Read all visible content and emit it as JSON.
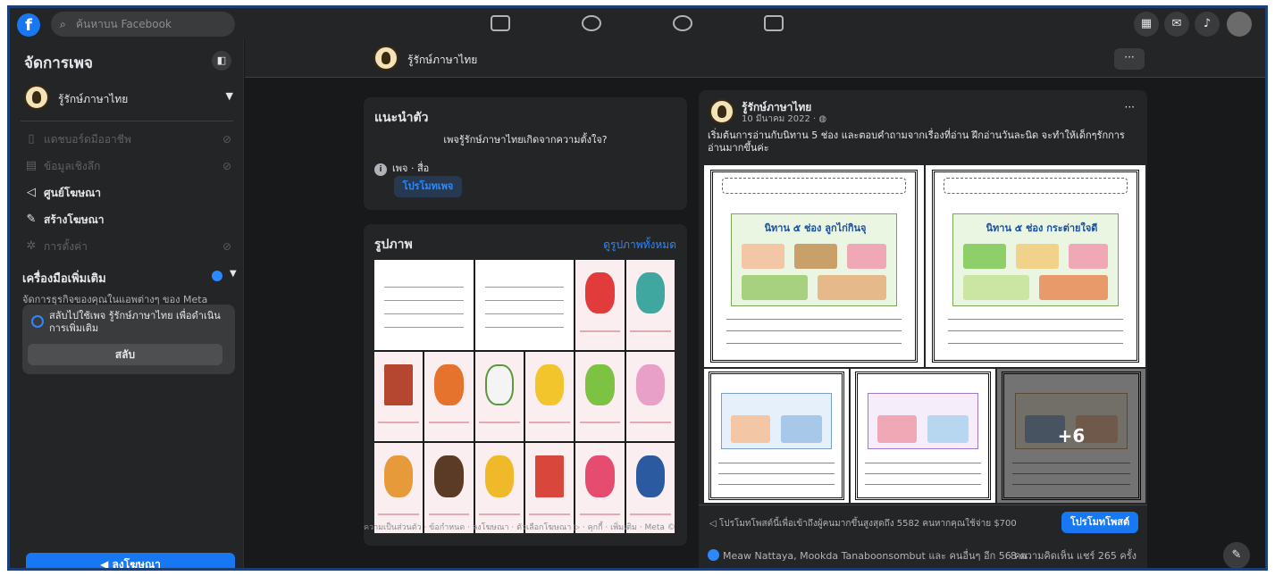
{
  "topbar": {
    "logo": "f",
    "search_placeholder": "ค้นหาบน Facebook"
  },
  "sidebar": {
    "title": "จัดการเพจ",
    "page_name": "รู้รักษ์ภาษาไทย",
    "items": [
      {
        "label": "แดชบอร์ดมืออาชีพ",
        "icon": "dashboard-icon",
        "state": "locked"
      },
      {
        "label": "ข้อมูลเชิงลึก",
        "icon": "insights-icon",
        "state": "locked"
      },
      {
        "label": "ศูนย์โฆษณา",
        "icon": "megaphone-icon",
        "state": "active"
      },
      {
        "label": "สร้างโฆษณา",
        "icon": "pencil-icon",
        "state": "active"
      },
      {
        "label": "การตั้งค่า",
        "icon": "gear-icon",
        "state": "locked"
      }
    ],
    "tools_title": "เครื่องมือเพิ่มเติม",
    "tools_subtitle": "จัดการธุรกิจของคุณในแอพต่างๆ ของ Meta",
    "switch_text": "สลับไปใช้เพจ รู้รักษ์ภาษาไทย เพื่อดำเนินการเพิ่มเติม",
    "switch_button": "สลับ",
    "ad_button": "ลงโฆษณา"
  },
  "page_header": {
    "page_name": "รู้รักษ์ภาษาไทย",
    "more": "···"
  },
  "intro": {
    "title": "แนะนำตัว",
    "description": "เพจรู้รักษ์ภาษาไทยเกิดจากความตั้งใจ?",
    "category": "เพจ · สื่อ",
    "promote_button": "โปรโมทเพจ"
  },
  "photos": {
    "title": "รูปภาพ",
    "see_all": "ดูรูปภาพทั้งหมด"
  },
  "footer_links": "ความเป็นส่วนตัว · ข้อกำหนด · ลงโฆษณา · ตัวเลือกโฆษณา ▷ · คุกกี้ · เพิ่มเติม · Meta ©",
  "post": {
    "author": "รู้รักษ์ภาษาไทย",
    "date": "10 มีนาคม 2022 · ",
    "more": "···",
    "text": "เริ่มต้นการอ่านกับนิทาน 5 ช่อง และตอบคำถามจากเรื่องที่อ่าน ฝึกอ่านวันละนิด จะทำให้เด็กๆรักการอ่านมากขึ้นค่ะ",
    "worksheet_titles": [
      "นิทาน ๕ ช่อง ลูกไก่กินจุ",
      "นิทาน ๕ ช่อง กระต่ายใจดี"
    ],
    "more_photos": "+6",
    "promo_text": "โปรโมทโพสต์นี้เพื่อเข้าถึงผู้คนมากขึ้นสูงสุดถึง 5582 คนหากคุณใช้จ่าย $700",
    "promo_button": "โปรโมทโพสต์",
    "reactions": "Meaw Nattaya, Mookda Tanaboonsombut และ คนอื่นๆ อีก 56 คน",
    "counts": "8 ความคิดเห็น  แชร์ 265 ครั้ง"
  },
  "colors": {
    "background": "#18191a",
    "surface": "#242526",
    "accent": "#1877f2",
    "link": "#2d88ff",
    "frame": "#1d3f78"
  }
}
